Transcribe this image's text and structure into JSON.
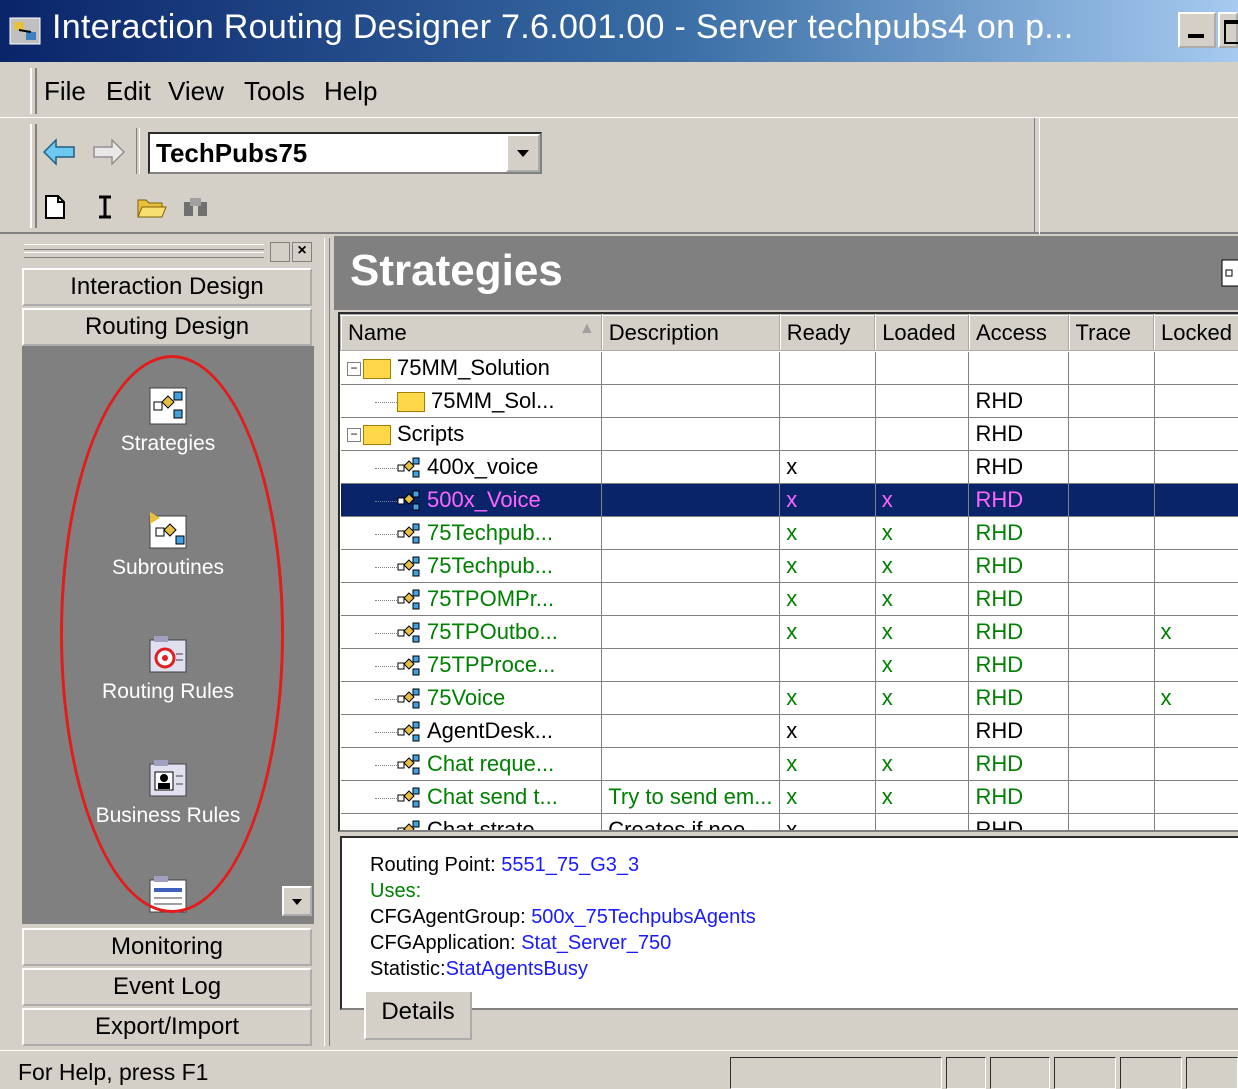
{
  "window": {
    "title": "Interaction Routing Designer  7.6.001.00  - Server techpubs4 on p...",
    "minimize_label": "_"
  },
  "menu": [
    "File",
    "Edit",
    "View",
    "Tools",
    "Help"
  ],
  "toolbar": {
    "tenant_value": "TechPubs75",
    "icons": [
      "back-arrow-icon",
      "forward-arrow-icon",
      "new-document-icon",
      "cursor-icon",
      "open-folder-icon",
      "find-icon"
    ]
  },
  "left_pane": {
    "sections_top": [
      "Interaction Design",
      "Routing Design"
    ],
    "nav_items": [
      {
        "label": "Strategies",
        "icon": "strategies-icon"
      },
      {
        "label": "Subroutines",
        "icon": "subroutines-icon"
      },
      {
        "label": "Routing Rules",
        "icon": "routing-rules-icon"
      },
      {
        "label": "Business Rules",
        "icon": "business-rules-icon"
      },
      {
        "label": "",
        "icon": "more-icon"
      }
    ],
    "sections_bottom": [
      "Monitoring",
      "Event Log",
      "Export/Import"
    ]
  },
  "main": {
    "header": "Strategies",
    "columns": [
      "Name",
      "Description",
      "Ready",
      "Loaded",
      "Access",
      "Trace",
      "Locked"
    ],
    "rows": [
      {
        "name": "75MM_Solution",
        "kind": "folder",
        "level": 0,
        "description": "",
        "ready": "",
        "loaded": "",
        "access": "",
        "trace": "",
        "locked": "",
        "color": "black"
      },
      {
        "name": "75MM_Sol...",
        "kind": "folder",
        "level": 1,
        "description": "",
        "ready": "",
        "loaded": "",
        "access": "RHD",
        "trace": "",
        "locked": "",
        "color": "black"
      },
      {
        "name": "Scripts",
        "kind": "folder",
        "level": 0,
        "description": "",
        "ready": "",
        "loaded": "",
        "access": "RHD",
        "trace": "",
        "locked": "",
        "color": "black"
      },
      {
        "name": "400x_voice",
        "kind": "script",
        "level": 1,
        "description": "",
        "ready": "x",
        "loaded": "",
        "access": "RHD",
        "trace": "",
        "locked": "",
        "color": "black"
      },
      {
        "name": "500x_Voice",
        "kind": "script",
        "level": 1,
        "description": "",
        "ready": "x",
        "loaded": "x",
        "access": "RHD",
        "trace": "",
        "locked": "",
        "color": "selected"
      },
      {
        "name": "75Techpub...",
        "kind": "script",
        "level": 1,
        "description": "",
        "ready": "x",
        "loaded": "x",
        "access": "RHD",
        "trace": "",
        "locked": "",
        "color": "green"
      },
      {
        "name": "75Techpub...",
        "kind": "script",
        "level": 1,
        "description": "",
        "ready": "x",
        "loaded": "x",
        "access": "RHD",
        "trace": "",
        "locked": "",
        "color": "green"
      },
      {
        "name": "75TPOMPr...",
        "kind": "script",
        "level": 1,
        "description": "",
        "ready": "x",
        "loaded": "x",
        "access": "RHD",
        "trace": "",
        "locked": "",
        "color": "green"
      },
      {
        "name": "75TPOutbo...",
        "kind": "script",
        "level": 1,
        "description": "",
        "ready": "x",
        "loaded": "x",
        "access": "RHD",
        "trace": "",
        "locked": "x",
        "color": "green"
      },
      {
        "name": "75TPProce...",
        "kind": "script",
        "level": 1,
        "description": "",
        "ready": "",
        "loaded": "x",
        "access": "RHD",
        "trace": "",
        "locked": "",
        "color": "green"
      },
      {
        "name": "75Voice",
        "kind": "script",
        "level": 1,
        "description": "",
        "ready": "x",
        "loaded": "x",
        "access": "RHD",
        "trace": "",
        "locked": "x",
        "color": "green"
      },
      {
        "name": "AgentDesk...",
        "kind": "script",
        "level": 1,
        "description": "",
        "ready": "x",
        "loaded": "",
        "access": "RHD",
        "trace": "",
        "locked": "",
        "color": "black"
      },
      {
        "name": "Chat reque...",
        "kind": "script",
        "level": 1,
        "description": "",
        "ready": "x",
        "loaded": "x",
        "access": "RHD",
        "trace": "",
        "locked": "",
        "color": "green"
      },
      {
        "name": "Chat send t...",
        "kind": "script",
        "level": 1,
        "description": "Try to send em...",
        "ready": "x",
        "loaded": "x",
        "access": "RHD",
        "trace": "",
        "locked": "",
        "color": "green"
      },
      {
        "name": "Chat strate...",
        "kind": "script",
        "level": 1,
        "description": "Creates if nee...",
        "ready": "x",
        "loaded": "",
        "access": "RHD",
        "trace": "",
        "locked": "",
        "color": "black"
      }
    ]
  },
  "details": {
    "lines": [
      {
        "label": "Routing Point:",
        "value": "5551_75_G3_3"
      },
      {
        "label": "Uses:",
        "value": ""
      },
      {
        "label": "CFGAgentGroup:",
        "value": "500x_75TechpubsAgents"
      },
      {
        "label": "CFGApplication:",
        "value": "Stat_Server_750"
      },
      {
        "label": "Statistic:",
        "value": "StatAgentsBusy"
      }
    ],
    "tab_label": "Details"
  },
  "status": {
    "text": "For Help, press F1"
  }
}
